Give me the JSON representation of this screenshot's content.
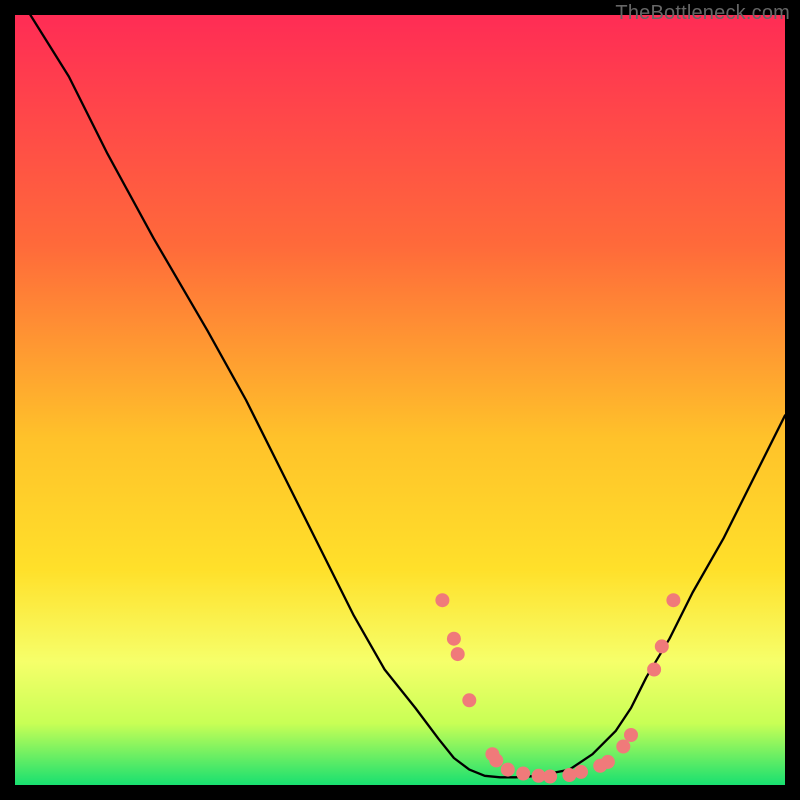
{
  "attribution": "TheBottleneck.com",
  "chart_data": {
    "type": "line",
    "title": "",
    "xlabel": "",
    "ylabel": "",
    "xlim": [
      0,
      100
    ],
    "ylim": [
      0,
      100
    ],
    "series": [
      {
        "name": "curve",
        "x": [
          2,
          7,
          12,
          18,
          25,
          30,
          35,
          40,
          44,
          48,
          52,
          55,
          57,
          59,
          61,
          63,
          65,
          68,
          72,
          75,
          78,
          80,
          82,
          85,
          88,
          92,
          96,
          100
        ],
        "values": [
          100,
          92,
          82,
          71,
          59,
          50,
          40,
          30,
          22,
          15,
          10,
          6,
          3.5,
          2,
          1.2,
          1,
          1,
          1.2,
          2,
          4,
          7,
          10,
          14,
          19,
          25,
          32,
          40,
          48
        ]
      }
    ],
    "markers": [
      {
        "x": 55.5,
        "y": 24
      },
      {
        "x": 57,
        "y": 19
      },
      {
        "x": 57.5,
        "y": 17
      },
      {
        "x": 59,
        "y": 11
      },
      {
        "x": 62,
        "y": 4
      },
      {
        "x": 62.5,
        "y": 3.2
      },
      {
        "x": 64,
        "y": 2
      },
      {
        "x": 66,
        "y": 1.5
      },
      {
        "x": 68,
        "y": 1.2
      },
      {
        "x": 69.5,
        "y": 1.1
      },
      {
        "x": 72,
        "y": 1.3
      },
      {
        "x": 73.5,
        "y": 1.7
      },
      {
        "x": 76,
        "y": 2.5
      },
      {
        "x": 77,
        "y": 3
      },
      {
        "x": 79,
        "y": 5
      },
      {
        "x": 80,
        "y": 6.5
      },
      {
        "x": 83,
        "y": 15
      },
      {
        "x": 84,
        "y": 18
      },
      {
        "x": 85.5,
        "y": 24
      }
    ],
    "gradient": {
      "top_color": "#FF2C55",
      "mid_upper_color": "#FF8A2A",
      "mid_color": "#FFE02A",
      "lower_band_color": "#F6FF6A",
      "bottom_color": "#18E070"
    },
    "marker_color": "#F07A7A",
    "line_color": "#000000"
  }
}
